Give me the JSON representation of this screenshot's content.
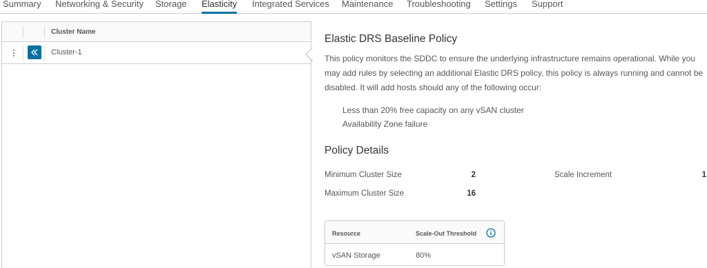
{
  "tabs": [
    {
      "label": "Summary",
      "active": false
    },
    {
      "label": "Networking & Security",
      "active": false
    },
    {
      "label": "Storage",
      "active": false
    },
    {
      "label": "Elasticity",
      "active": true
    },
    {
      "label": "Integrated Services",
      "active": false
    },
    {
      "label": "Maintenance",
      "active": false
    },
    {
      "label": "Troubleshooting",
      "active": false
    },
    {
      "label": "Settings",
      "active": false
    },
    {
      "label": "Support",
      "active": false
    }
  ],
  "grid": {
    "column_header": "Cluster Name",
    "rows": [
      {
        "name": "Cluster-1"
      }
    ]
  },
  "detail": {
    "title": "Elastic DRS Baseline Policy",
    "description": "This policy monitors the SDDC to ensure the underlying infrastructure remains operational. While you may add rules by selecting an additional Elastic DRS policy, this policy is always running and cannot be disabled. It will add hosts should any of the following occur:",
    "conditions": [
      "Less than 20% free capacity on any vSAN cluster",
      "Availability Zone failure"
    ],
    "policy_details_title": "Policy Details",
    "min_cluster_size_label": "Minimum Cluster Size",
    "min_cluster_size_value": "2",
    "max_cluster_size_label": "Maximum Cluster Size",
    "max_cluster_size_value": "16",
    "scale_increment_label": "Scale Increment",
    "scale_increment_value": "1",
    "threshold_table": {
      "headers": [
        "Resource",
        "Scale-Out Threshold"
      ],
      "rows": [
        {
          "resource": "vSAN Storage",
          "threshold": "80%"
        }
      ]
    }
  },
  "colors": {
    "accent": "#0072a3",
    "border": "#cccccc",
    "text": "#565656"
  },
  "icons": {
    "row_menu": "vertical-ellipsis-icon",
    "expand": "double-chevron-left-icon",
    "info": "info-circle-icon"
  }
}
